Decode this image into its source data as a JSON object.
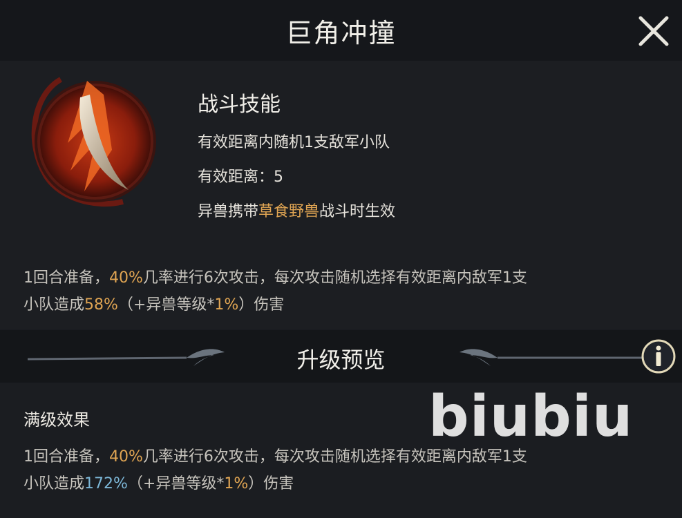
{
  "dialog": {
    "title": "巨角冲撞",
    "close_icon": "close-icon"
  },
  "skill": {
    "icon": "horn-skill-icon",
    "type": "战斗技能",
    "target": "有效距离内随机1支敌军小队",
    "range": "有效距离：5",
    "condition_prefix": "异兽携带",
    "condition_highlight": "草食野兽",
    "condition_suffix": "战斗时生效"
  },
  "current_effect": {
    "part1": "1回合准备，",
    "chance": "40%",
    "part2": "几率进行6次攻击，每次攻击随机选择有效距离内敌军1支",
    "part3": "小队造成",
    "damage": "58%",
    "part4": "（+异兽等级*",
    "scale": "1%",
    "part5": "）伤害"
  },
  "upgrade": {
    "title": "升级预览",
    "info_icon": "info-icon"
  },
  "max_level": {
    "label": "满级效果",
    "part1": "1回合准备，",
    "chance": "40%",
    "part2": "几率进行6次攻击，每次攻击随机选择有效距离内敌军1支",
    "part3": "小队造成",
    "damage": "172%",
    "part4": "（+异兽等级*",
    "scale": "1%",
    "part5": "）伤害"
  },
  "watermark": "biubiu",
  "colors": {
    "highlight_gold": "#e0a553",
    "highlight_blue": "#7cb6d6",
    "background": "#1a1c21"
  }
}
